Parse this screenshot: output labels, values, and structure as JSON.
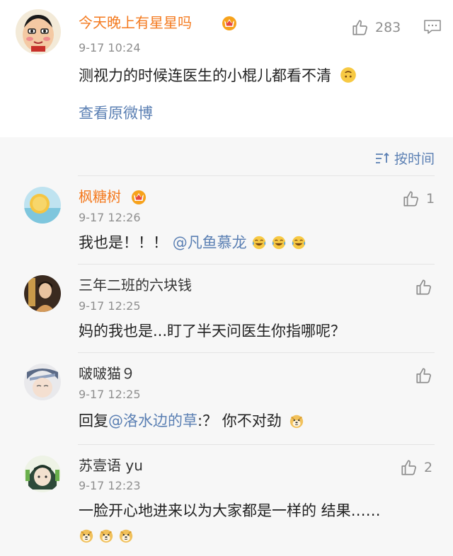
{
  "post": {
    "username": "今天晚上有星星吗",
    "time": "9-17 10:24",
    "text": "测视力的时候连医生的小棍儿都看不清",
    "like_count": "283",
    "view_original": "查看原微博"
  },
  "sort": {
    "label": "按时间"
  },
  "replies": [
    {
      "username": "枫糖树",
      "time": "9-17 12:26",
      "text_prefix": "我也是！！！",
      "mention": "@凡鱼慕龙",
      "like_count": "1"
    },
    {
      "username": "三年二班的六块钱",
      "time": "9-17 12:25",
      "text": "妈的我也是...盯了半天问医生你指哪呢？",
      "like_count": ""
    },
    {
      "username": "啵啵猫９",
      "time": "9-17 12:25",
      "text_prefix": "回复",
      "mention": "@洛水边的草",
      "text_suffix": ":？ 你不对劲",
      "like_count": ""
    },
    {
      "username": "苏壹语 yu",
      "time": "9-17 12:23",
      "text": "一脸开心地进来以为大家都是一样的 结果……",
      "like_count": "2"
    }
  ],
  "icons": {
    "like": "thumbs-up-icon",
    "comment": "comment-icon",
    "sort": "sort-icon",
    "vip": "vip-crown-badge-icon",
    "emoji_laugh_cry": "laugh-cry-emoji-icon",
    "emoji_doge": "doge-emoji-icon",
    "emoji_upside_down": "upside-down-face-emoji-icon"
  },
  "colors": {
    "username_vip": "#f47a1f",
    "link": "#5a7fb3",
    "meta": "#8f8f8f",
    "background": "#f7f7f7"
  }
}
